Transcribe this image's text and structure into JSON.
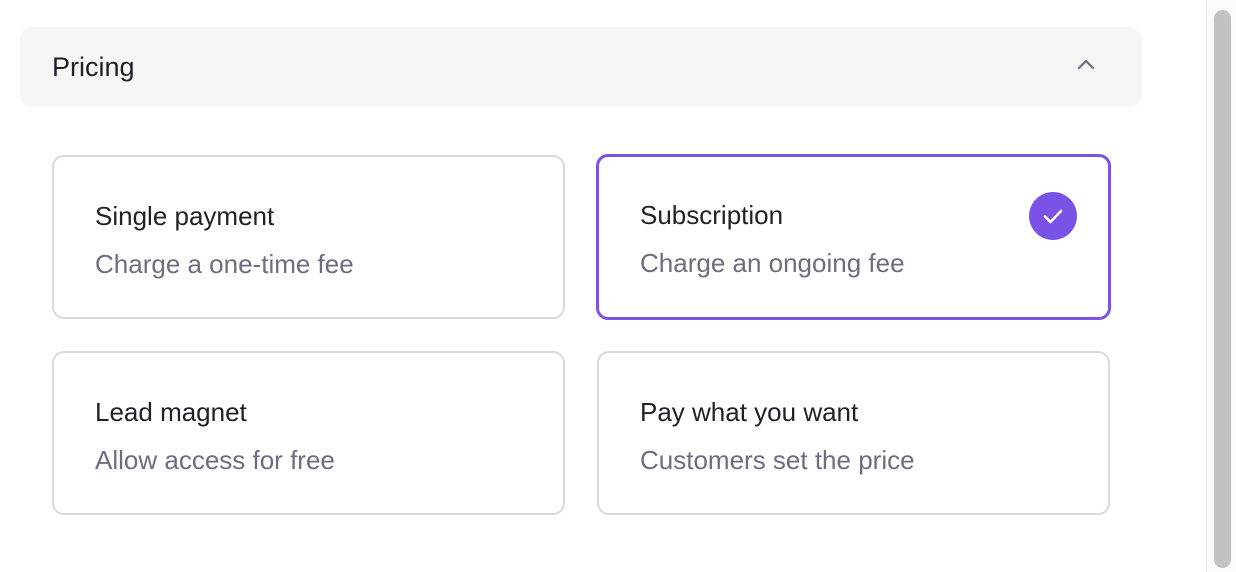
{
  "section": {
    "title": "Pricing",
    "toggle_icon": "chevron-up-icon"
  },
  "options": [
    {
      "title": "Single payment",
      "description": "Charge a one-time fee",
      "selected": false
    },
    {
      "title": "Subscription",
      "description": "Charge an ongoing fee",
      "selected": true
    },
    {
      "title": "Lead magnet",
      "description": "Allow access for free",
      "selected": false
    },
    {
      "title": "Pay what you want",
      "description": "Customers set the price",
      "selected": false
    }
  ],
  "colors": {
    "accent": "#7a52e6",
    "header_bg": "#f6f6f7",
    "card_border": "#d9d9de",
    "text_primary": "#1f2028",
    "text_secondary": "#6b6e80"
  }
}
